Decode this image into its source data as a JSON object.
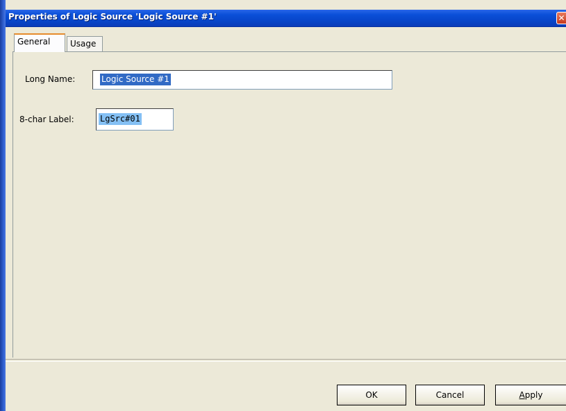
{
  "window": {
    "title": "Properties of Logic Source 'Logic Source #1'",
    "close_glyph": "✕"
  },
  "tabs": [
    {
      "label": "General",
      "active": true
    },
    {
      "label": "Usage",
      "active": false
    }
  ],
  "form": {
    "long_name_label": "Long Name:",
    "long_name_value": "Logic Source #1",
    "label8_label": "8-char Label:",
    "label8_value": "LgSrc#01"
  },
  "buttons": {
    "ok": "OK",
    "cancel": "Cancel",
    "apply_first": "A",
    "apply_rest": "pply"
  },
  "colors": {
    "titlebar": "#0a4fd8",
    "selection": "#316ac5",
    "dialog_bg": "#ece9d8"
  }
}
